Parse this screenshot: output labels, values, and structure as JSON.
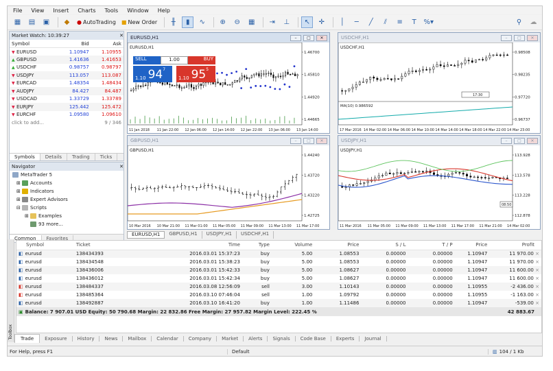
{
  "menu": [
    "File",
    "View",
    "Insert",
    "Charts",
    "Tools",
    "Window",
    "Help"
  ],
  "toolbar": {
    "autotrading": "AutoTrading",
    "new_order": "New Order"
  },
  "market_watch": {
    "title": "Market Watch: 10:39:27",
    "col_symbol": "Symbol",
    "col_bid": "Bid",
    "col_ask": "Ask",
    "rows": [
      {
        "symbol": "EURUSD",
        "bid": "1.10947",
        "ask": "1.10955"
      },
      {
        "symbol": "GBPUSD",
        "bid": "1.41636",
        "ask": "1.41653"
      },
      {
        "symbol": "USDCHF",
        "bid": "0.98757",
        "ask": "0.98797"
      },
      {
        "symbol": "USDJPY",
        "bid": "113.057",
        "ask": "113.087"
      },
      {
        "symbol": "EURCAD",
        "bid": "1.48354",
        "ask": "1.48434"
      },
      {
        "symbol": "AUDJPY",
        "bid": "84.427",
        "ask": "84.487"
      },
      {
        "symbol": "USDCAD",
        "bid": "1.33729",
        "ask": "1.33789"
      },
      {
        "symbol": "EURJPY",
        "bid": "125.442",
        "ask": "125.472"
      },
      {
        "symbol": "EURCHF",
        "bid": "1.09580",
        "ask": "1.09610"
      }
    ],
    "add": "click to add...",
    "count": "9 / 346",
    "tabs": [
      "Symbols",
      "Details",
      "Trading",
      "Ticks"
    ]
  },
  "navigator": {
    "title": "Navigator",
    "root": "MetaTrader 5",
    "items": [
      "Accounts",
      "Indicators",
      "Expert Advisors",
      "Scripts"
    ],
    "sub": [
      "Examples",
      "93 more..."
    ],
    "tabs": [
      "Common",
      "Favorites"
    ]
  },
  "charts": [
    {
      "title": "EURUSD,H1",
      "label": "EURUSD,H1",
      "yticks": [
        "1.46700",
        "1.45810",
        "1.44920",
        "1.44665"
      ],
      "xticks": [
        "11 Jan 2018",
        "11 Jan 22:00",
        "12 Jan 06:00",
        "12 Jan 14:00",
        "12 Jan 22:00",
        "13 Jan 06:00",
        "13 Jan 14:00"
      ],
      "trade": {
        "sell": "SELL",
        "buy": "BUY",
        "lot": "1.00",
        "sell_pre": "1.10",
        "sell_big": "94",
        "sell_sup": "7",
        "buy_pre": "1.10",
        "buy_big": "95",
        "buy_sup": "5"
      }
    },
    {
      "title": "USDCHF,H1",
      "label": "USDCHF,H1",
      "yticks": [
        "0.98508",
        "0.98235",
        "0.97720",
        "0.96737"
      ],
      "xticks": [
        "17 Mar 2016",
        "14 Mar 02:00",
        "14 Mar 06:00",
        "14 Mar 10:00",
        "14 Mar 14:00",
        "14 Mar 18:00",
        "14 Mar 22:00",
        "14 Mar 23:00"
      ],
      "ma": "MA(10) 0.986592",
      "hlabel": "17:30"
    },
    {
      "title": "GBPUSD,H1",
      "label": "GBPUSD,H1",
      "yticks": [
        "1.44240",
        "1.43720",
        "1.43220",
        "1.42725"
      ],
      "xticks": [
        "10 Mar 2016",
        "10 Mar 21:00",
        "11 Mar 01:00",
        "11 Mar 05:00",
        "11 Mar 09:00",
        "11 Mar 13:00",
        "11 Mar 17:00"
      ]
    },
    {
      "title": "USDJPY,H1",
      "label": "USDJPY,H1",
      "yticks": [
        "113.928",
        "113.578",
        "113.228",
        "112.878"
      ],
      "xticks": [
        "11 Mar 2016",
        "11 Mar 05:00",
        "11 Mar 09:00",
        "11 Mar 13:00",
        "11 Mar 17:00",
        "11 Mar 21:00",
        "14 Mar 02:00"
      ],
      "hlabel": "08:50"
    }
  ],
  "chart_tabs": [
    "EURUSD,H1",
    "GBPUSD,H1",
    "USDJPY,H1",
    "USDCHF,H1"
  ],
  "toolbox": {
    "headers": [
      "Symbol",
      "Ticket",
      "Time",
      "Type",
      "Volume",
      "Price",
      "S / L",
      "T / P",
      "Price",
      "Profit"
    ],
    "rows": [
      [
        "eurusd",
        "138434393",
        "2016.03.01 15:37:23",
        "buy",
        "5.00",
        "1.08553",
        "0.00000",
        "0.00000",
        "1.10947",
        "11 970.00"
      ],
      [
        "eurusd",
        "138434548",
        "2016.03.01 15:38:23",
        "buy",
        "5.00",
        "1.08553",
        "0.00000",
        "0.00000",
        "1.10947",
        "11 970.00"
      ],
      [
        "eurusd",
        "138436006",
        "2016.03.01 15:42:33",
        "buy",
        "5.00",
        "1.08627",
        "0.00000",
        "0.00000",
        "1.10947",
        "11 600.00"
      ],
      [
        "eurusd",
        "138436012",
        "2016.03.01 15:42:34",
        "buy",
        "5.00",
        "1.08627",
        "0.00000",
        "0.00000",
        "1.10947",
        "11 600.00"
      ],
      [
        "eurusd",
        "138484337",
        "2016.03.08 12:56:09",
        "sell",
        "3.00",
        "1.10143",
        "0.00000",
        "0.00000",
        "1.10955",
        "-2 436.00"
      ],
      [
        "eurusd",
        "138485364",
        "2016.03.10 07:46:04",
        "sell",
        "1.00",
        "1.09792",
        "0.00000",
        "0.00000",
        "1.10955",
        "-1 163.00"
      ],
      [
        "eurusd",
        "138492887",
        "2016.03.10 16:41:20",
        "buy",
        "1.00",
        "1.11486",
        "0.00000",
        "0.00000",
        "1.10947",
        "-539.00"
      ]
    ],
    "balance": "Balance: 7 907.01 USD  Equity: 50 790.68  Margin: 22 832.86  Free Margin: 27 957.82  Margin Level: 222.45 %",
    "total": "42 883.67",
    "side": "Toolbox"
  },
  "bottom_tabs": [
    "Trade",
    "Exposure",
    "History",
    "News",
    "Mailbox",
    "Calendar",
    "Company",
    "Market",
    "Alerts",
    "Signals",
    "Code Base",
    "Experts",
    "Journal"
  ],
  "status": {
    "help": "For Help, press F1",
    "profile": "Default",
    "traffic": "104 / 1 Kb"
  },
  "colors": {
    "buy": "#d8362b",
    "sell": "#1f63c6",
    "bid": "#1f3fd6",
    "ask": "#d11"
  }
}
